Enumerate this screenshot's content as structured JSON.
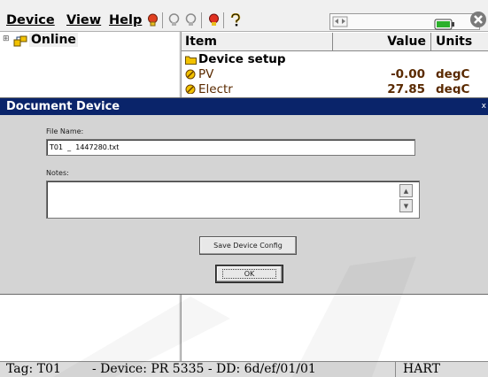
{
  "menubar": {
    "menus": [
      "Device",
      "View",
      "Help"
    ],
    "icons": [
      "device-status-icon",
      "refresh-icon",
      "connect-icon",
      "alert-icon",
      "help-icon"
    ],
    "network_icon": "network-icon",
    "battery_icon": "battery-icon",
    "close_icon": "close-icon"
  },
  "tree": {
    "expander": "⊞",
    "root_label": "Online"
  },
  "table": {
    "columns": [
      "Item",
      "Value",
      "Units"
    ],
    "rows": [
      {
        "item": "Device setup",
        "value": "",
        "units": "",
        "icon": "folder-icon"
      },
      {
        "item": "PV",
        "value": "-0.00",
        "units": "degC",
        "icon": "variable-icon"
      },
      {
        "item": "Electr",
        "value": "27.85",
        "units": "degC",
        "icon": "variable-icon"
      }
    ]
  },
  "dialog": {
    "title": "Document Device",
    "file_name_label": "File Name:",
    "file_name_value": "T01  _  1447280.txt",
    "notes_label": "Notes:",
    "notes_value": "",
    "save_config_label": "Save Device Config",
    "ok_label": "OK",
    "close_glyph": "x"
  },
  "status": {
    "tag": "Tag: T01",
    "device": "- Device: PR 5335 - DD: 6d/ef/01/01",
    "protocol": "HART"
  },
  "colors": {
    "title_bar": "#0a246a",
    "folder": "#f2c200",
    "battery": "#2bb02b"
  }
}
